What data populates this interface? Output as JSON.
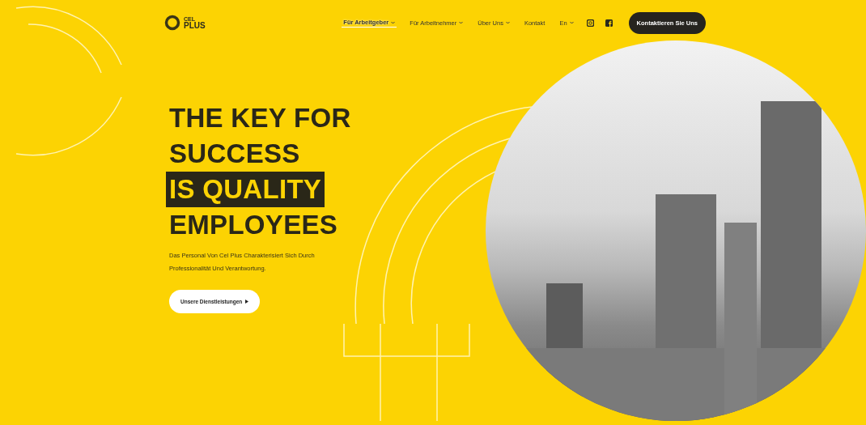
{
  "logo": {
    "small": "CEL",
    "large": "PLUS"
  },
  "nav": [
    {
      "label": "Für Arbeitgeber",
      "dropdown": true,
      "selected": true
    },
    {
      "label": "Für Arbeitnehmer",
      "dropdown": true,
      "selected": false
    },
    {
      "label": "Über Uns",
      "dropdown": true,
      "selected": false
    },
    {
      "label": "Kontakt",
      "dropdown": false,
      "selected": false
    },
    {
      "label": "En",
      "dropdown": true,
      "selected": false
    }
  ],
  "cta": "Kontaktieren Sie Uns",
  "hero": {
    "headline": [
      {
        "text": "THE KEY FOR",
        "highlighted": false
      },
      {
        "text": "SUCCESS",
        "highlighted": false
      },
      {
        "text": "IS QUALITY",
        "highlighted": true
      },
      {
        "text": "EMPLOYEES",
        "highlighted": false
      }
    ],
    "tagline": "Das Personal Von Cel Plus Charakterisiert Sich Durch Professionalität Und Verantwortung.",
    "button": "Unsere Dienstleistungen"
  }
}
